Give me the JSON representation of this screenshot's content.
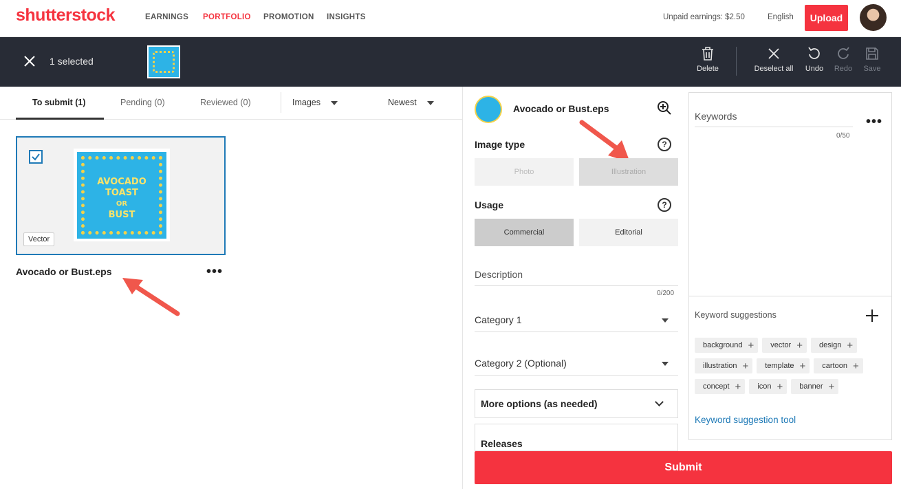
{
  "brand": {
    "logo_text": "shutterstock",
    "accent": "#f5333f",
    "link_color": "#1f7ab7",
    "dark_bar": "#282c36"
  },
  "topnav": {
    "links": [
      "EARNINGS",
      "PORTFOLIO",
      "PROMOTION",
      "INSIGHTS"
    ],
    "active_link": "PORTFOLIO",
    "unpaid_earnings": "Unpaid earnings: $2.50",
    "language": "English",
    "upload_label": "Upload",
    "avatar_icon": "user-avatar"
  },
  "selection_bar": {
    "count_label": "1 selected",
    "tools": {
      "delete": "Delete",
      "deselect_all": "Deselect all",
      "undo": "Undo",
      "redo": "Redo",
      "save": "Save"
    }
  },
  "tabs": {
    "to_submit": "To submit (1)",
    "pending": "Pending (0)",
    "reviewed": "Reviewed (0)",
    "type_filter": "Images",
    "sort": "Newest"
  },
  "asset": {
    "name": "Avocado or Bust.eps",
    "badge": "Vector",
    "checked": true,
    "art_text": [
      "AVOCADO",
      "TOAST",
      "OR",
      "BUST"
    ]
  },
  "detail": {
    "title": "Avocado or Bust.eps",
    "image_type": {
      "heading": "Image type",
      "options": [
        "Photo",
        "Illustration"
      ],
      "selected": "Illustration"
    },
    "usage": {
      "heading": "Usage",
      "options": [
        "Commercial",
        "Editorial"
      ],
      "selected": "Commercial"
    },
    "description": {
      "label": "Description",
      "counter": "0/200"
    },
    "category1": "Category 1",
    "category2": "Category 2 (Optional)",
    "more_options": "More options (as needed)",
    "releases": "Releases"
  },
  "keywords": {
    "label": "Keywords",
    "counter": "0/50",
    "suggestions_label": "Keyword suggestions",
    "chips": [
      "background",
      "vector",
      "design",
      "illustration",
      "template",
      "cartoon",
      "concept",
      "icon",
      "banner"
    ],
    "tool_link": "Keyword suggestion tool"
  },
  "submit_label": "Submit"
}
